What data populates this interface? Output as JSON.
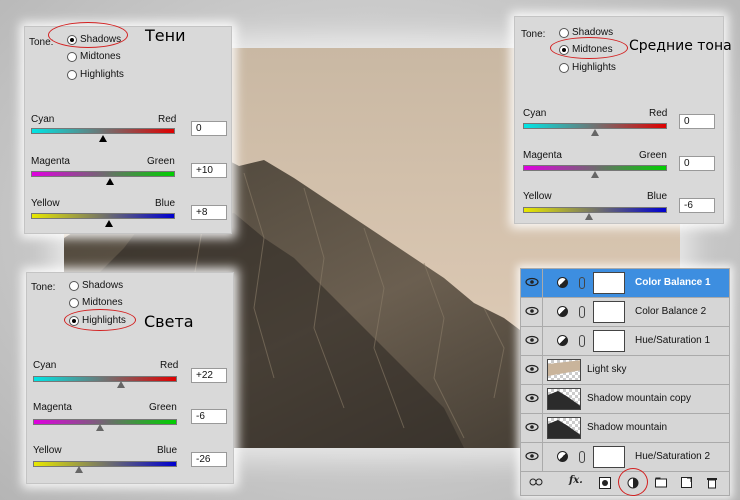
{
  "captions": {
    "shadows": "Тени",
    "midtones": "Средние тона",
    "highlights": "Света"
  },
  "panel_shadows": {
    "tone": "Tone:",
    "options": [
      "Shadows",
      "Midtones",
      "Highlights"
    ],
    "selected": "Shadows",
    "sliders": [
      {
        "left": "Cyan",
        "right": "Red",
        "value": "0",
        "level": 0
      },
      {
        "left": "Magenta",
        "right": "Green",
        "value": "+10",
        "level": 10
      },
      {
        "left": "Yellow",
        "right": "Blue",
        "value": "+8",
        "level": 8
      }
    ]
  },
  "panel_midtones": {
    "tone": "Tone:",
    "options": [
      "Shadows",
      "Midtones",
      "Highlights"
    ],
    "selected": "Midtones",
    "sliders": [
      {
        "left": "Cyan",
        "right": "Red",
        "value": "0",
        "level": 0
      },
      {
        "left": "Magenta",
        "right": "Green",
        "value": "0",
        "level": 0
      },
      {
        "left": "Yellow",
        "right": "Blue",
        "value": "-6",
        "level": -6
      }
    ]
  },
  "panel_highlights": {
    "tone": "Tone:",
    "options": [
      "Shadows",
      "Midtones",
      "Highlights"
    ],
    "selected": "Highlights",
    "sliders": [
      {
        "left": "Cyan",
        "right": "Red",
        "value": "+22",
        "level": 22
      },
      {
        "left": "Magenta",
        "right": "Green",
        "value": "-6",
        "level": -6
      },
      {
        "left": "Yellow",
        "right": "Blue",
        "value": "-26",
        "level": -26
      }
    ]
  },
  "layers": [
    {
      "name": "Color Balance 1",
      "kind": "adjustment",
      "selected": true
    },
    {
      "name": "Color Balance 2",
      "kind": "adjustment",
      "selected": false
    },
    {
      "name": "Hue/Saturation 1",
      "kind": "adjustment",
      "selected": false
    },
    {
      "name": "Light sky",
      "kind": "image-sky",
      "selected": false
    },
    {
      "name": "Shadow mountain copy",
      "kind": "image-mountain",
      "selected": false
    },
    {
      "name": "Shadow mountain",
      "kind": "image-mountain",
      "selected": false
    },
    {
      "name": "Hue/Saturation 2",
      "kind": "adjustment-linked",
      "selected": false
    }
  ],
  "layer_toolbar": [
    "link-icon",
    "fx-icon",
    "mask-icon",
    "new-adjustment-icon",
    "folder-icon",
    "new-layer-icon",
    "trash-icon"
  ],
  "fx_label": "fx.",
  "colors": {
    "selected_row": "#3d8ee0",
    "highlight_ring": "#d32020"
  }
}
